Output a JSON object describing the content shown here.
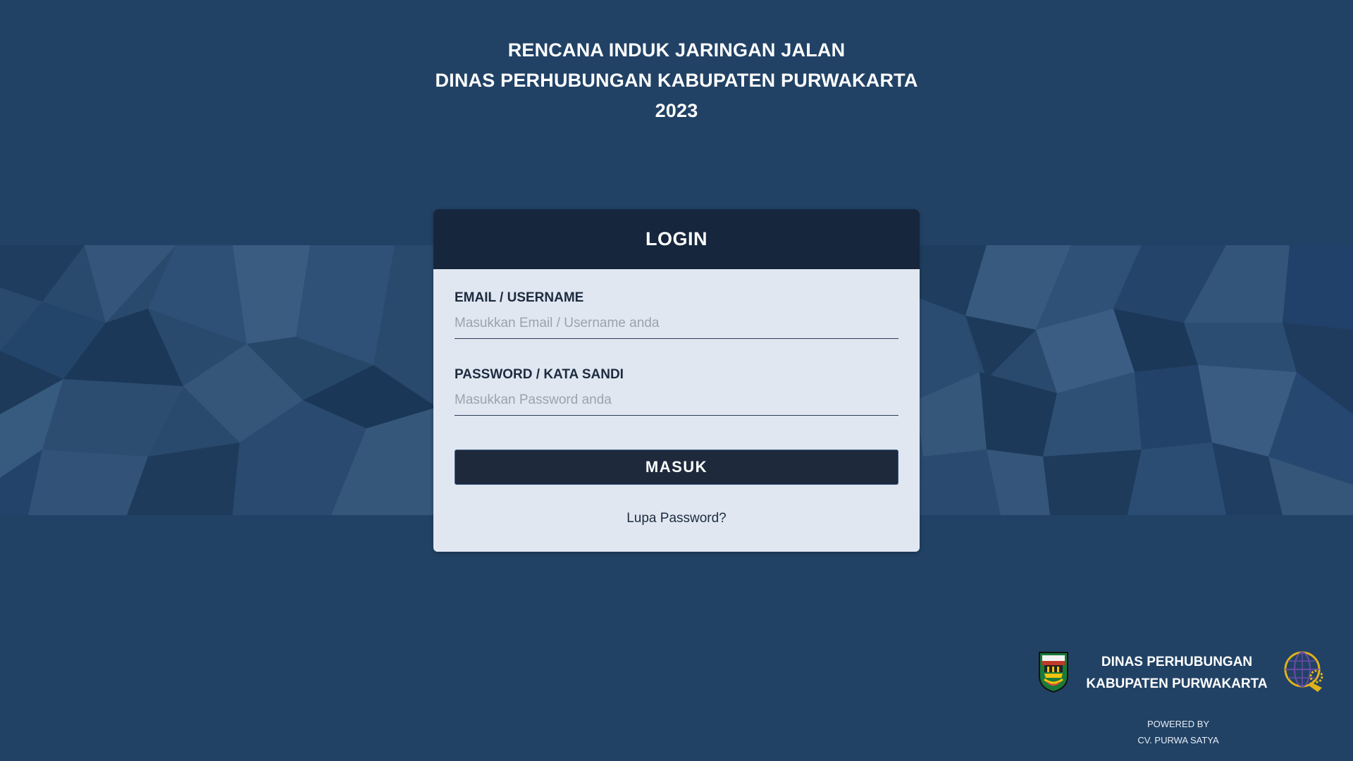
{
  "header": {
    "line1": "RENCANA INDUK JARINGAN JALAN",
    "line2": "DINAS PERHUBUNGAN KABUPATEN PURWAKARTA",
    "line3": "2023"
  },
  "login": {
    "title": "LOGIN",
    "email_label": "EMAIL / USERNAME",
    "email_placeholder": "Masukkan Email / Username anda",
    "password_label": "PASSWORD / KATA SANDI",
    "password_placeholder": "Masukkan Password anda",
    "submit_label": "MASUK",
    "forgot_label": "Lupa Password?"
  },
  "footer": {
    "org_line1": "DINAS PERHUBUNGAN",
    "org_line2": "KABUPATEN PURWAKARTA",
    "powered_line1": "POWERED BY",
    "powered_line2": "CV. PURWA SATYA",
    "left_logo_icon": "purwakarta-regency-emblem-icon",
    "right_logo_icon": "dishub-globe-emblem-icon"
  },
  "colors": {
    "background": "#214265",
    "card_header": "#16263c",
    "card_body": "#e1e7f1",
    "button": "#1e2a3c"
  }
}
